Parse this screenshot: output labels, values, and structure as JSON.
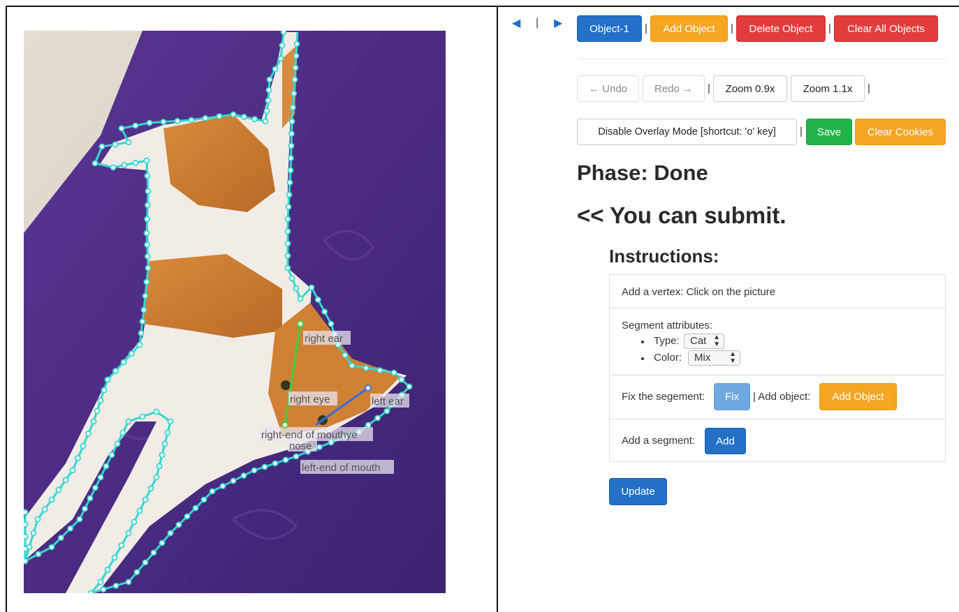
{
  "nav": {
    "prev_icon": "triangle-left-icon",
    "separator": "|",
    "next_icon": "triangle-right-icon"
  },
  "toolbar": {
    "object_label": "Object-1",
    "add_object_label": "Add Object",
    "delete_object_label": "Delete Object",
    "clear_all_label": "Clear All Objects",
    "separator": "|"
  },
  "actions": {
    "undo_label": "← Undo",
    "redo_label": "Redo →",
    "zoom_out_label": "Zoom 0.9x",
    "zoom_in_label": "Zoom 1.1x",
    "overlay_label": "Disable Overlay Mode [shortcut: 'o' key]",
    "save_label": "Save",
    "clear_cookies_label": "Clear Cookies"
  },
  "status": {
    "phase": "Phase: Done",
    "submit": "<< You can submit."
  },
  "instructions": {
    "title": "Instructions:",
    "vertex": "Add a vertex: Click on the picture",
    "segment_attributes": "Segment attributes:",
    "type_label": "Type:",
    "type_value": "Cat",
    "color_label": "Color:",
    "color_value": "Mix",
    "fix_text": "Fix the segement:",
    "fix_button": "Fix",
    "add_object_text": "| Add object:",
    "add_object_button": "Add Object",
    "add_segment_text": "Add a segment:",
    "add_button": "Add"
  },
  "update_label": "Update",
  "keypoints": {
    "right_ear": "right ear",
    "left_ear": "left ear",
    "right_eye": "right eye",
    "right_end_mouth": "right-end of mouthye",
    "nose": "nose",
    "left_end_mouth": "left-end of mouth"
  },
  "colors": {
    "polygon": "#33d6d0",
    "mat": "#4a2a80",
    "floor": "#d9d2c8",
    "blue_button": "#2271c7",
    "orange_button": "#f5a623",
    "red_button": "#e23c3c",
    "green_button": "#24b24a"
  }
}
